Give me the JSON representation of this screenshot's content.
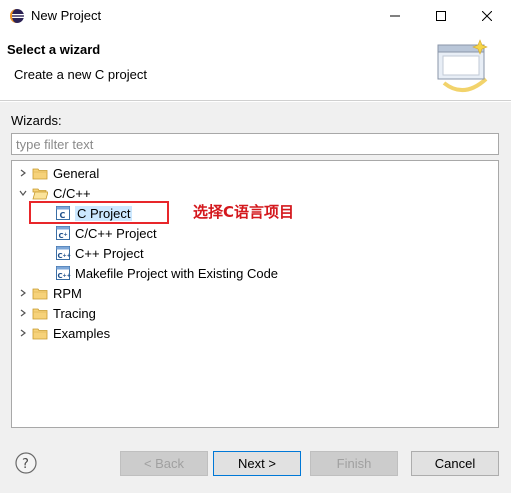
{
  "window": {
    "title": "New Project"
  },
  "header": {
    "title": "Select a wizard",
    "description": "Create a new C project"
  },
  "wizards": {
    "label": "Wizards:",
    "filter_placeholder": "type filter text",
    "tree": [
      {
        "label": "General",
        "expanded": false,
        "type": "folder"
      },
      {
        "label": "C/C++",
        "expanded": true,
        "type": "folder",
        "children": [
          {
            "label": "C Project",
            "selected": true,
            "icon": "c-project-icon"
          },
          {
            "label": "C/C++ Project",
            "icon": "c-cpp-project-icon"
          },
          {
            "label": "C++ Project",
            "icon": "cpp-project-icon"
          },
          {
            "label": "Makefile Project with Existing Code",
            "icon": "makefile-project-icon"
          }
        ]
      },
      {
        "label": "RPM",
        "expanded": false,
        "type": "folder"
      },
      {
        "label": "Tracing",
        "expanded": false,
        "type": "folder"
      },
      {
        "label": "Examples",
        "expanded": false,
        "type": "folder"
      }
    ]
  },
  "annotation": {
    "text": "选择C语言项目",
    "color": "#d4181d"
  },
  "buttons": {
    "back": "< Back",
    "next": "Next >",
    "finish": "Finish",
    "cancel": "Cancel"
  },
  "colors": {
    "selection": "#cce8ff",
    "annotation_box": "#e8262a",
    "default_button_border": "#0078d7"
  }
}
